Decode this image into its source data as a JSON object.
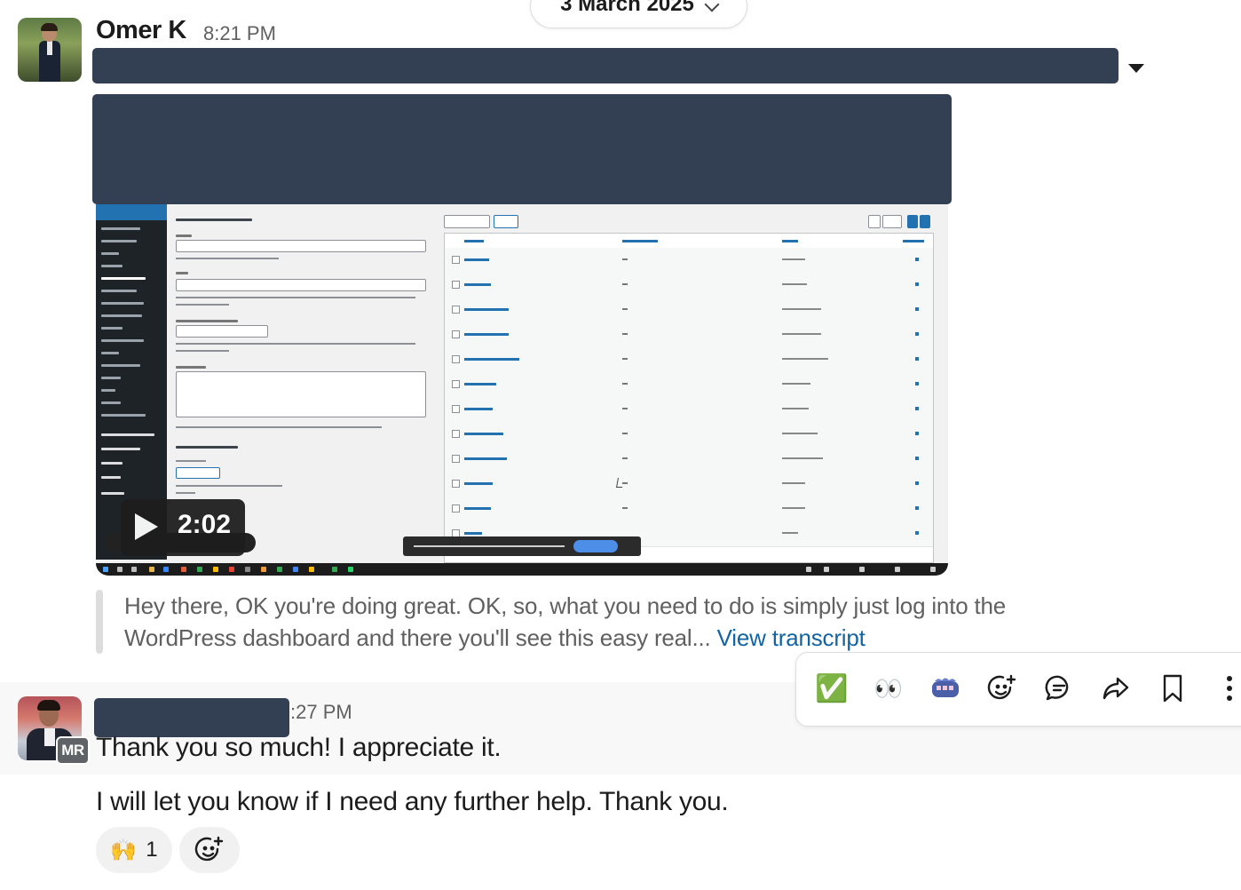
{
  "date_divider": {
    "label": "3 March 2025"
  },
  "message1": {
    "author": "Omer K",
    "time": "8:21 PM",
    "video": {
      "duration": "2:02"
    },
    "transcript": {
      "text": "Hey there, OK you're doing great. OK, so, what you need to do is simply just log into the WordPress dashboard and there you'll see this easy real...",
      "link": "View transcript"
    }
  },
  "message_actions": {
    "icons": [
      "check-mark-emoji-icon",
      "eyes-emoji-icon",
      "custom-emoji-icon",
      "add-reaction-icon",
      "reply-in-thread-icon",
      "forward-icon",
      "bookmark-icon",
      "more-actions-icon"
    ],
    "check_emoji": "✅",
    "eyes_emoji": "👀"
  },
  "message2": {
    "badge": "MR",
    "time_suffix": ":27 PM",
    "lines": [
      "Thank you so much! I appreciate it.",
      "I will let you know if I need any further help. Thank you."
    ],
    "reaction": {
      "emoji": "🙌",
      "count": "1"
    }
  },
  "colors": {
    "redaction": "#333f52",
    "link": "#1264a3",
    "muted_text": "#616061"
  }
}
